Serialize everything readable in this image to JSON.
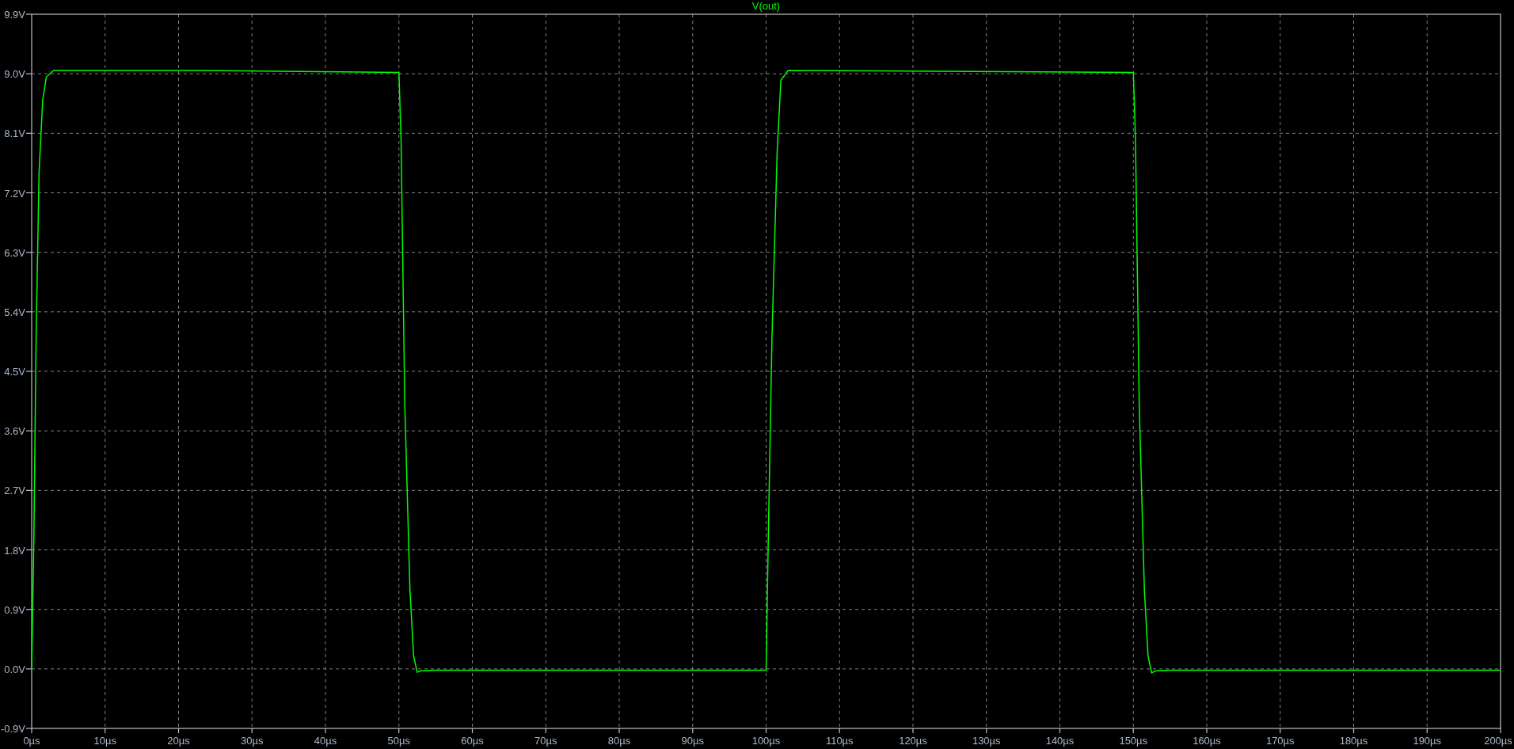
{
  "plot": {
    "chart_data": {
      "type": "line",
      "grid": true,
      "x": [
        0,
        0.3,
        0.6,
        1,
        1.5,
        2,
        3,
        22,
        50,
        50.3,
        50.8,
        51.5,
        52,
        52.5,
        53,
        55,
        100,
        100.3,
        100.8,
        101.5,
        102,
        103,
        150,
        150.3,
        150.8,
        151.5,
        152,
        152.5,
        153,
        155,
        200
      ],
      "series": [
        {
          "name": "V(out)",
          "color": "#00ff00",
          "values": [
            0,
            2,
            5,
            7.5,
            8.6,
            8.95,
            9.05,
            9.05,
            9.02,
            8,
            4,
            1.2,
            0.2,
            -0.05,
            -0.03,
            -0.02,
            -0.02,
            2,
            5,
            7.8,
            8.9,
            9.05,
            9.02,
            8,
            4,
            1.2,
            0.2,
            -0.06,
            -0.03,
            -0.02,
            -0.02
          ]
        }
      ],
      "xlim": [
        0,
        200
      ],
      "ylim": [
        -0.9,
        9.9
      ],
      "xticks": [
        {
          "value": 0,
          "label": "0µs"
        },
        {
          "value": 10,
          "label": "10µs"
        },
        {
          "value": 20,
          "label": "20µs"
        },
        {
          "value": 30,
          "label": "30µs"
        },
        {
          "value": 40,
          "label": "40µs"
        },
        {
          "value": 50,
          "label": "50µs"
        },
        {
          "value": 60,
          "label": "60µs"
        },
        {
          "value": 70,
          "label": "70µs"
        },
        {
          "value": 80,
          "label": "80µs"
        },
        {
          "value": 90,
          "label": "90µs"
        },
        {
          "value": 100,
          "label": "100µs"
        },
        {
          "value": 110,
          "label": "110µs"
        },
        {
          "value": 120,
          "label": "120µs"
        },
        {
          "value": 130,
          "label": "130µs"
        },
        {
          "value": 140,
          "label": "140µs"
        },
        {
          "value": 150,
          "label": "150µs"
        },
        {
          "value": 160,
          "label": "160µs"
        },
        {
          "value": 170,
          "label": "170µs"
        },
        {
          "value": 180,
          "label": "180µs"
        },
        {
          "value": 190,
          "label": "190µs"
        },
        {
          "value": 200,
          "label": "200µs"
        }
      ],
      "yticks": [
        {
          "value": -0.9,
          "label": "-0.9V"
        },
        {
          "value": 0,
          "label": "0.0V"
        },
        {
          "value": 0.9,
          "label": "0.9V"
        },
        {
          "value": 1.8,
          "label": "1.8V"
        },
        {
          "value": 2.7,
          "label": "2.7V"
        },
        {
          "value": 3.6,
          "label": "3.6V"
        },
        {
          "value": 4.5,
          "label": "4.5V"
        },
        {
          "value": 5.4,
          "label": "5.4V"
        },
        {
          "value": 6.3,
          "label": "6.3V"
        },
        {
          "value": 7.2,
          "label": "7.2V"
        },
        {
          "value": 8.1,
          "label": "8.1V"
        },
        {
          "value": 9.0,
          "label": "9.0V"
        },
        {
          "value": 9.9,
          "label": "9.9V"
        }
      ]
    }
  }
}
